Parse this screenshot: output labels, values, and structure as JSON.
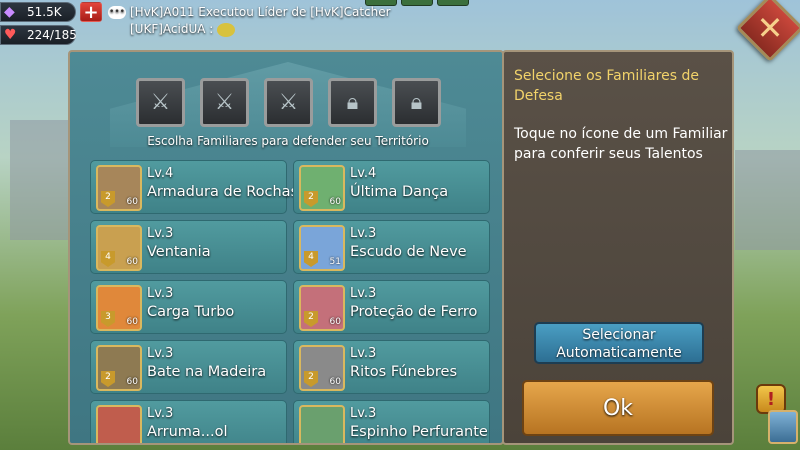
{
  "hud": {
    "gems": "51.5K",
    "stamina": "224/185",
    "gem_icon": "gem-icon",
    "heart_icon": "heart-icon",
    "plus_label": "+"
  },
  "chat": {
    "line1": "[HvK]A011 Executou Líder de [HvK]Catcher",
    "line2": "[UKF]AcidUA :"
  },
  "panel": {
    "caption": "Escolha Familiares para defender seu Território",
    "slots": [
      {
        "icon": "dragon-crest-icon",
        "locked": false
      },
      {
        "icon": "dragon-crest-icon",
        "locked": false
      },
      {
        "icon": "dragon-crest-icon",
        "locked": false
      },
      {
        "icon": "lock-icon",
        "locked": true
      },
      {
        "icon": "lock-icon",
        "locked": true
      }
    ]
  },
  "familiars": [
    {
      "level": "Lv.4",
      "name": "Armadura de Rochas",
      "stars": "2",
      "badge": "60",
      "color": "#a7865a"
    },
    {
      "level": "Lv.4",
      "name": "Última Dança",
      "stars": "2",
      "badge": "60",
      "color": "#6fb070"
    },
    {
      "level": "Lv.3",
      "name": "Ventania",
      "stars": "4",
      "badge": "60",
      "color": "#c9a050"
    },
    {
      "level": "Lv.3",
      "name": "Escudo de Neve",
      "stars": "4",
      "badge": "51",
      "color": "#7aa5d9"
    },
    {
      "level": "Lv.3",
      "name": "Carga Turbo",
      "stars": "3",
      "badge": "60",
      "color": "#e0883a"
    },
    {
      "level": "Lv.3",
      "name": "Proteção de Ferro",
      "stars": "2",
      "badge": "60",
      "color": "#c4707a"
    },
    {
      "level": "Lv.3",
      "name": "Bate na Madeira",
      "stars": "2",
      "badge": "60",
      "color": "#8e7a52"
    },
    {
      "level": "Lv.3",
      "name": "Ritos Fúnebres",
      "stars": "2",
      "badge": "60",
      "color": "#8a8a8a"
    },
    {
      "level": "Lv.3",
      "name": "Arruma...ol",
      "stars": "",
      "badge": "",
      "color": "#c05d4d"
    },
    {
      "level": "Lv.3",
      "name": "Espinho Perfurante",
      "stars": "",
      "badge": "",
      "color": "#6aa06e"
    }
  ],
  "info": {
    "title": "Selecione os Familiares de Defesa",
    "text": "Toque no ícone de um Familiar para conferir seus Talentos",
    "auto_button": "Selecionar Automaticamente",
    "ok_button": "Ok"
  },
  "colors": {
    "panel": "#4e8a95",
    "info_panel": "#5a5147",
    "gold_text": "#f2d36a",
    "ok_button": "#e6a64b",
    "auto_button": "#4a9ec3"
  }
}
